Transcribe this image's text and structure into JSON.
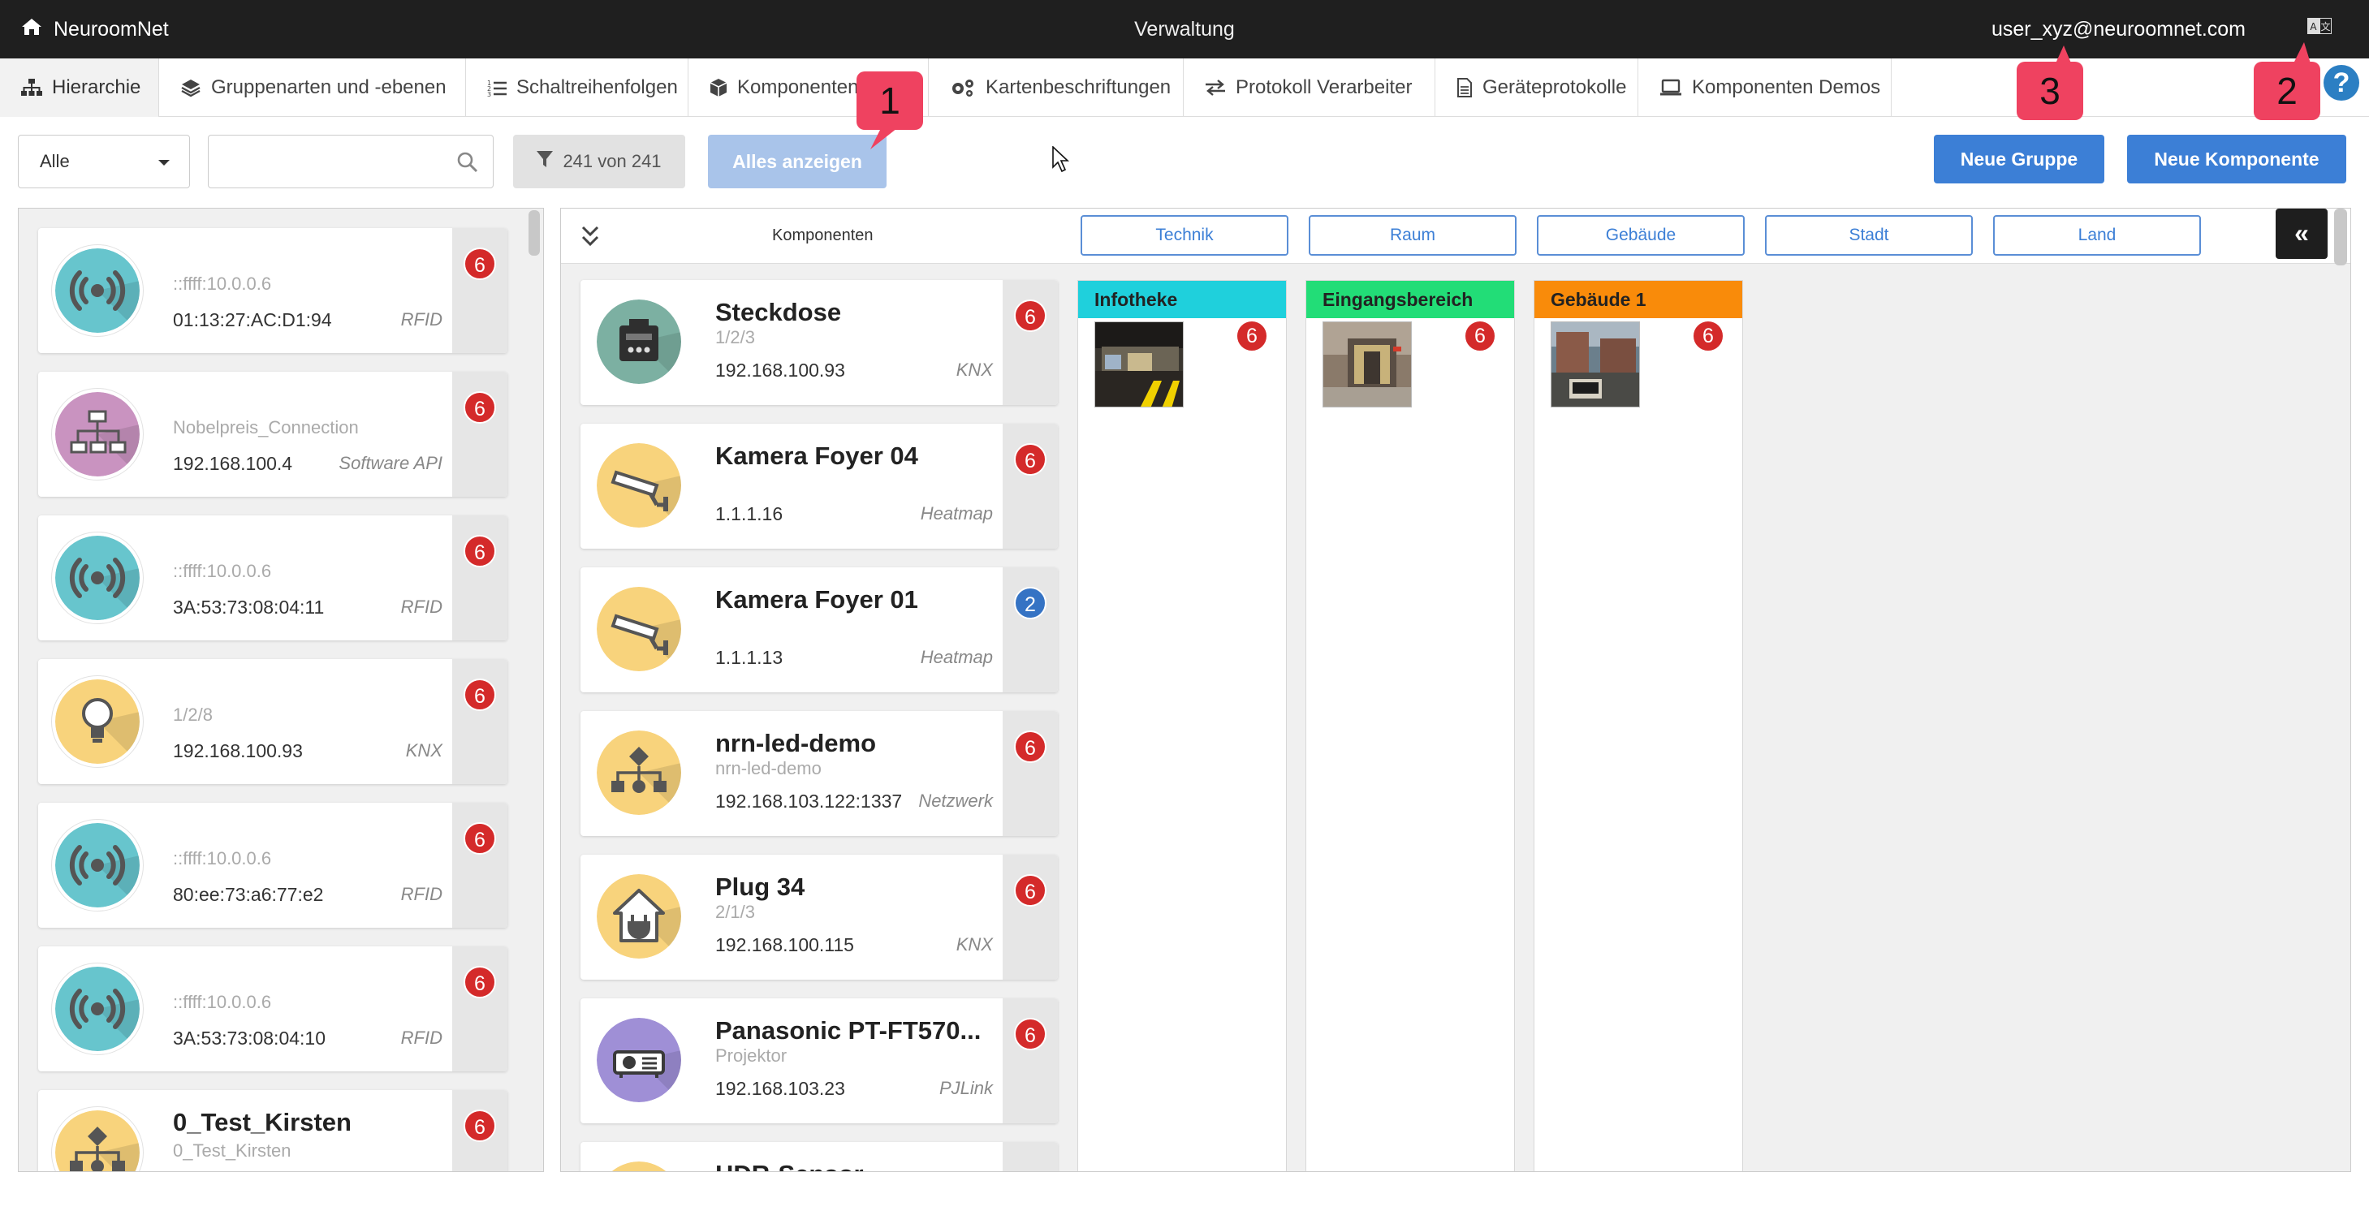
{
  "topbar": {
    "brand": "NeuroomNet",
    "title": "Verwaltung",
    "user_email": "user_xyz@neuroomnet.com"
  },
  "tabs": [
    {
      "label": "Hierarchie",
      "icon": "sitemap-icon",
      "active": true
    },
    {
      "label": "Gruppenarten und -ebenen",
      "icon": "layers-icon"
    },
    {
      "label": "Schaltreihenfolgen",
      "icon": "ordered-list-icon"
    },
    {
      "label": "Komponenten",
      "icon": "cube-icon"
    },
    {
      "label": "Kartenbeschriftungen",
      "icon": "cogs-icon"
    },
    {
      "label": "Protokoll Verarbeiter",
      "icon": "exchange-icon"
    },
    {
      "label": "Geräteprotokolle",
      "icon": "file-icon"
    },
    {
      "label": "Komponenten Demos",
      "icon": "laptop-icon"
    }
  ],
  "badges": [
    "1",
    "2",
    "3"
  ],
  "toolbar": {
    "select_value": "Alle",
    "search_placeholder": "",
    "filter_count": "241 von 241",
    "show_all": "Alles anzeigen",
    "new_group": "Neue Gruppe",
    "new_component": "Neue Komponente"
  },
  "left_list": [
    {
      "title": "",
      "sub": "::ffff:10.0.0.6",
      "addr": "01:13:27:AC:D1:94",
      "proto": "RFID",
      "count": "6",
      "icon": "rfid-signal-icon"
    },
    {
      "title": "",
      "sub": "Nobelpreis_Connection",
      "addr": "192.168.100.4",
      "proto": "Software API",
      "count": "6",
      "icon": "network-api-icon"
    },
    {
      "title": "",
      "sub": "::ffff:10.0.0.6",
      "addr": "3A:53:73:08:04:11",
      "proto": "RFID",
      "count": "6",
      "icon": "rfid-signal-icon"
    },
    {
      "title": "",
      "sub": "1/2/8",
      "addr": "192.168.100.93",
      "proto": "KNX",
      "count": "6",
      "icon": "lightbulb-icon"
    },
    {
      "title": "",
      "sub": "::ffff:10.0.0.6",
      "addr": "80:ee:73:a6:77:e2",
      "proto": "RFID",
      "count": "6",
      "icon": "rfid-signal-icon"
    },
    {
      "title": "",
      "sub": "::ffff:10.0.0.6",
      "addr": "3A:53:73:08:04:10",
      "proto": "RFID",
      "count": "6",
      "icon": "rfid-signal-icon"
    },
    {
      "title": "0_Test_Kirsten",
      "sub": "0_Test_Kirsten",
      "addr": "",
      "proto": "",
      "count": "6",
      "icon": "network-icon"
    }
  ],
  "main": {
    "title": "Komponenten",
    "levels": [
      "Technik",
      "Raum",
      "Gebäude",
      "Stadt",
      "Land"
    ],
    "components": [
      {
        "title": "Steckdose",
        "sub": "1/2/3",
        "addr": "192.168.100.93",
        "proto": "KNX",
        "count": "6",
        "icon": "socket-icon"
      },
      {
        "title": "Kamera Foyer 04",
        "sub": "",
        "addr": "1.1.1.16",
        "proto": "Heatmap",
        "count": "6",
        "icon": "camera-icon"
      },
      {
        "title": "Kamera Foyer 01",
        "sub": "",
        "addr": "1.1.1.13",
        "proto": "Heatmap",
        "count": "2",
        "icon": "camera-icon"
      },
      {
        "title": "nrn-led-demo",
        "sub": "nrn-led-demo",
        "addr": "192.168.103.122:1337",
        "proto": "Netzwerk",
        "count": "6",
        "icon": "network-icon"
      },
      {
        "title": "Plug 34",
        "sub": "2/1/3",
        "addr": "192.168.100.115",
        "proto": "KNX",
        "count": "6",
        "icon": "house-plug-icon"
      },
      {
        "title": "Panasonic PT-FT570...",
        "sub": "Projektor",
        "addr": "192.168.103.23",
        "proto": "PJLink",
        "count": "6",
        "icon": "projector-icon"
      },
      {
        "title": "HDR-Sensor",
        "sub": "",
        "addr": "",
        "proto": "",
        "count": "",
        "icon": "sensor-icon"
      }
    ],
    "groups": [
      {
        "name": "Infotheke",
        "color": "#1fd0dc",
        "count": "6"
      },
      {
        "name": "Eingangsbereich",
        "color": "#22dd77",
        "count": "6"
      },
      {
        "name": "Gebäude 1",
        "color": "#f98b0a",
        "count": "6"
      }
    ]
  },
  "colors": {
    "accent": "#3c7fd6",
    "badge": "#ef4260",
    "count_red": "#d42a2a",
    "count_blue": "#3573c4",
    "teal": "#67c5cd",
    "yellow": "#f8d37c",
    "purple": "#c993c0",
    "lavender": "#9f8fd6",
    "sage": "#7cb0a2"
  }
}
